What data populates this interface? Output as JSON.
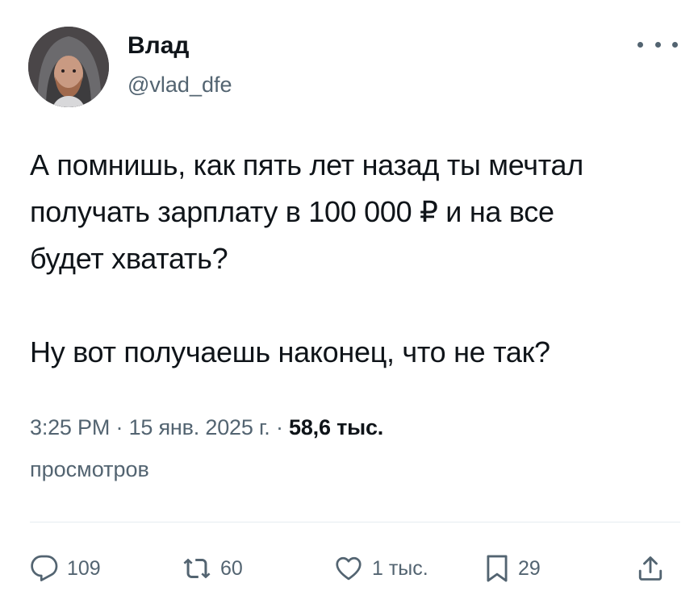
{
  "author": {
    "name": "Влад",
    "handle": "@vlad_dfe",
    "avatar_icon": "avatar-hooded-man"
  },
  "tweet": {
    "text": "А помнишь, как пять лет назад ты мечтал\nполучать зарплату в 100 000 ₽ и на все\nбудет хватать?\n\nНу вот получаешь наконец, что не так?"
  },
  "meta": {
    "time": "3:25 PM",
    "separator": "·",
    "date": "15 янв. 2025 г.",
    "views_count": "58,6 тыс.",
    "views_label": "просмотров"
  },
  "actions": {
    "replies": "109",
    "reposts": "60",
    "likes": "1 тыс.",
    "bookmarks": "29"
  },
  "colors": {
    "text": "#0f1419",
    "secondary": "#536471",
    "divider": "#e6ecf0"
  },
  "icons": {
    "more": "more-dots-icon",
    "reply": "reply-icon",
    "repost": "repost-icon",
    "like": "like-heart-icon",
    "bookmark": "bookmark-icon",
    "share": "share-icon"
  }
}
